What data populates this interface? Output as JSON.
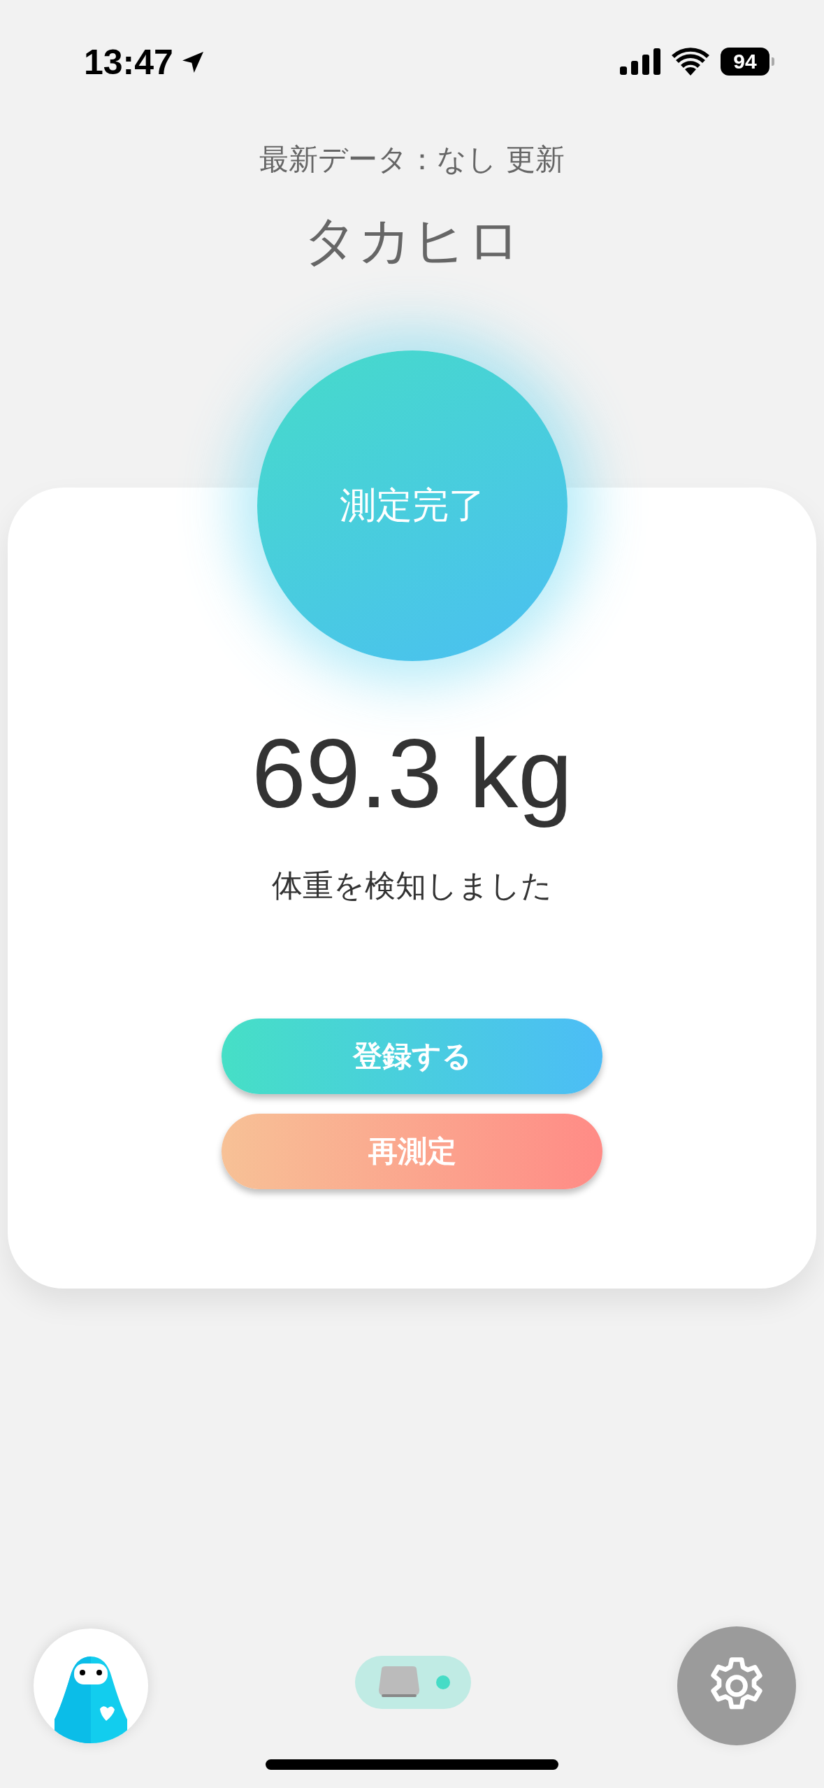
{
  "status_bar": {
    "time": "13:47",
    "battery": "94"
  },
  "header": {
    "subtitle": "最新データ：なし 更新",
    "user_name": "タカヒロ"
  },
  "result": {
    "status": "測定完了",
    "weight": "69.3 kg",
    "message": "体重を検知しました"
  },
  "buttons": [
    {
      "label": "登録する",
      "kind": "primary"
    },
    {
      "label": "再測定",
      "kind": "secondary"
    }
  ],
  "device": {
    "connected": true
  }
}
